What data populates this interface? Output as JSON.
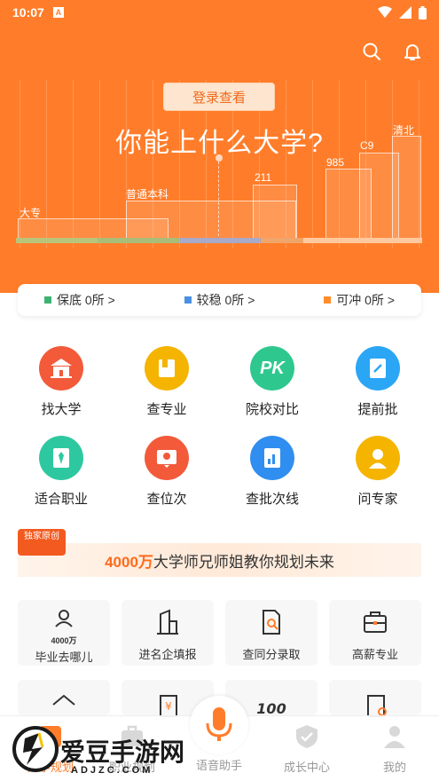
{
  "status": {
    "time": "10:07",
    "a_badge": "A"
  },
  "hero": {
    "login_label": "登录查看",
    "title": "你能上什么大学?",
    "levels": [
      "大专",
      "普通本科",
      "211",
      "985",
      "C9",
      "清北"
    ]
  },
  "counts": [
    {
      "label": "保底 0所 >",
      "color": "#3cb371"
    },
    {
      "label": "较稳 0所 >",
      "color": "#4a90e2"
    },
    {
      "label": "可冲 0所 >",
      "color": "#ff8c2a"
    }
  ],
  "features": [
    {
      "label": "找大学",
      "icon": "school-icon",
      "color": "#f25a3a"
    },
    {
      "label": "查专业",
      "icon": "book-icon",
      "color": "#f5b400"
    },
    {
      "label": "院校对比",
      "icon": "pk-icon",
      "color": "#2ec88f",
      "text": "PK"
    },
    {
      "label": "提前批",
      "icon": "document-icon",
      "color": "#2aa6f5"
    },
    {
      "label": "适合职业",
      "icon": "tie-icon",
      "color": "#2ec8a0"
    },
    {
      "label": "查位次",
      "icon": "location-icon",
      "color": "#f25a3a"
    },
    {
      "label": "查批次线",
      "icon": "bar-chart-icon",
      "color": "#2f8ef0"
    },
    {
      "label": "问专家",
      "icon": "expert-icon",
      "color": "#f5b400"
    }
  ],
  "banner": {
    "badge": "独家原创",
    "highlight": "4000万",
    "text": "大学师兄师姐教你规划未来"
  },
  "cards": [
    {
      "label": "毕业去哪儿",
      "icon": "person-4000-icon",
      "sub": "4000万"
    },
    {
      "label": "进名企填报",
      "icon": "building-icon"
    },
    {
      "label": "查同分录取",
      "icon": "search-doc-icon"
    },
    {
      "label": "高薪专业",
      "icon": "briefcase-icon"
    }
  ],
  "nav": [
    {
      "label": "升学规划",
      "icon": "plan-icon",
      "active": true
    },
    {
      "label": "职业规划",
      "icon": "career-icon"
    },
    {
      "label": "语音助手",
      "icon": "mic-icon"
    },
    {
      "label": "成长中心",
      "icon": "growth-icon"
    },
    {
      "label": "我的",
      "icon": "profile-icon"
    }
  ],
  "watermark": {
    "text": "爱豆手游网",
    "sub": "ADJZC.COM"
  }
}
